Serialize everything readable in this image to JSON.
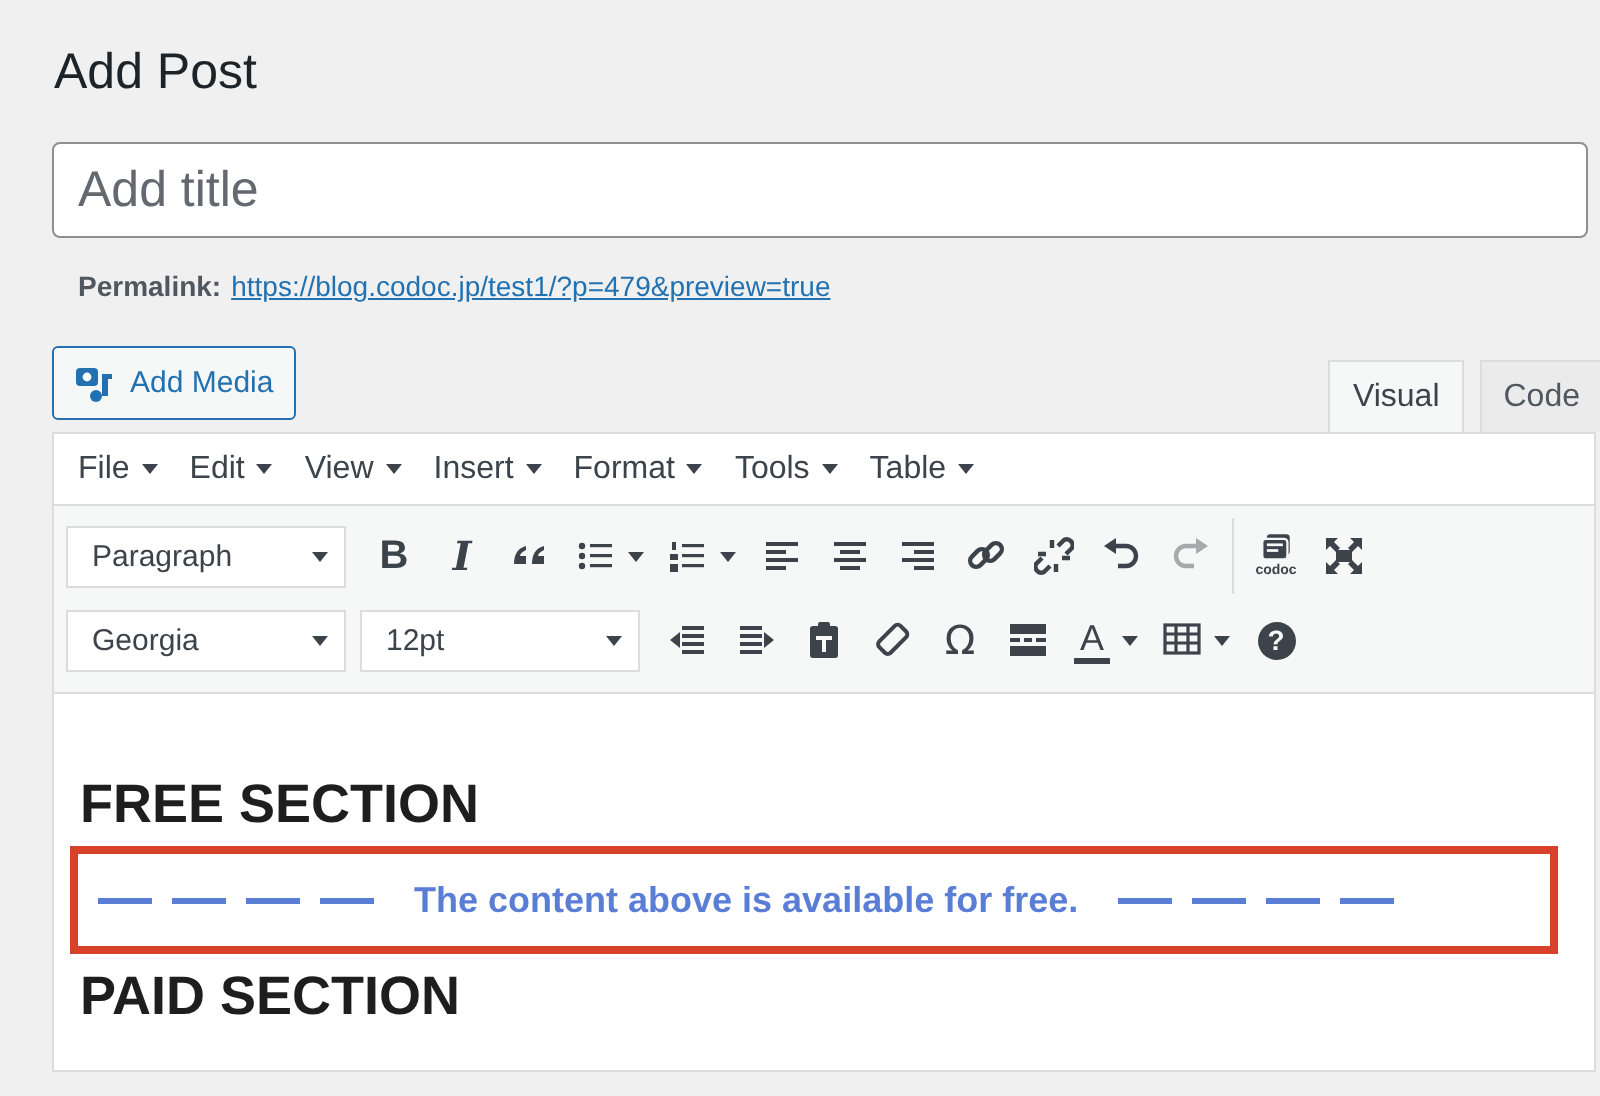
{
  "page_title": "Add Post",
  "title_field": {
    "placeholder": "Add title"
  },
  "permalink": {
    "label": "Permalink:",
    "url": "https://blog.codoc.jp/test1/?p=479&preview=true"
  },
  "add_media": {
    "label": "Add Media"
  },
  "tabs": [
    {
      "label": "Visual",
      "selected": true
    },
    {
      "label": "Code",
      "selected": false
    }
  ],
  "menu": [
    {
      "label": "File"
    },
    {
      "label": "Edit"
    },
    {
      "label": "View"
    },
    {
      "label": "Insert"
    },
    {
      "label": "Format"
    },
    {
      "label": "Tools"
    },
    {
      "label": "Table"
    }
  ],
  "toolbar_rows": [
    [
      {
        "kind": "select",
        "value": "Paragraph"
      },
      {
        "kind": "bold",
        "glyph": "B"
      },
      {
        "kind": "italic",
        "glyph": "I"
      },
      {
        "kind": "quote"
      },
      {
        "kind": "bullets",
        "dropdown": true
      },
      {
        "kind": "numbers",
        "dropdown": true
      },
      {
        "kind": "alignleft"
      },
      {
        "kind": "aligncenter"
      },
      {
        "kind": "alignright"
      },
      {
        "kind": "link"
      },
      {
        "kind": "unlink"
      },
      {
        "kind": "undo"
      },
      {
        "kind": "redo",
        "disabled": true
      },
      {
        "kind": "separator"
      },
      {
        "kind": "codoc",
        "caption": "codoc"
      },
      {
        "kind": "fullscreen"
      }
    ],
    [
      {
        "kind": "select",
        "value": "Georgia"
      },
      {
        "kind": "select",
        "value": "12pt"
      },
      {
        "kind": "outdent"
      },
      {
        "kind": "indent"
      },
      {
        "kind": "pastetext"
      },
      {
        "kind": "eraser"
      },
      {
        "kind": "symbol",
        "glyph": "Ω"
      },
      {
        "kind": "readmore"
      },
      {
        "kind": "textcolor",
        "glyph": "A",
        "dropdown": true
      },
      {
        "kind": "table",
        "dropdown": true
      },
      {
        "kind": "help",
        "glyph": "?"
      }
    ]
  ],
  "content": [
    {
      "kind": "heading",
      "text": "FREE SECTION"
    },
    {
      "kind": "divider",
      "text": "The content above is available for free."
    },
    {
      "kind": "heading",
      "text": "PAID SECTION"
    }
  ]
}
